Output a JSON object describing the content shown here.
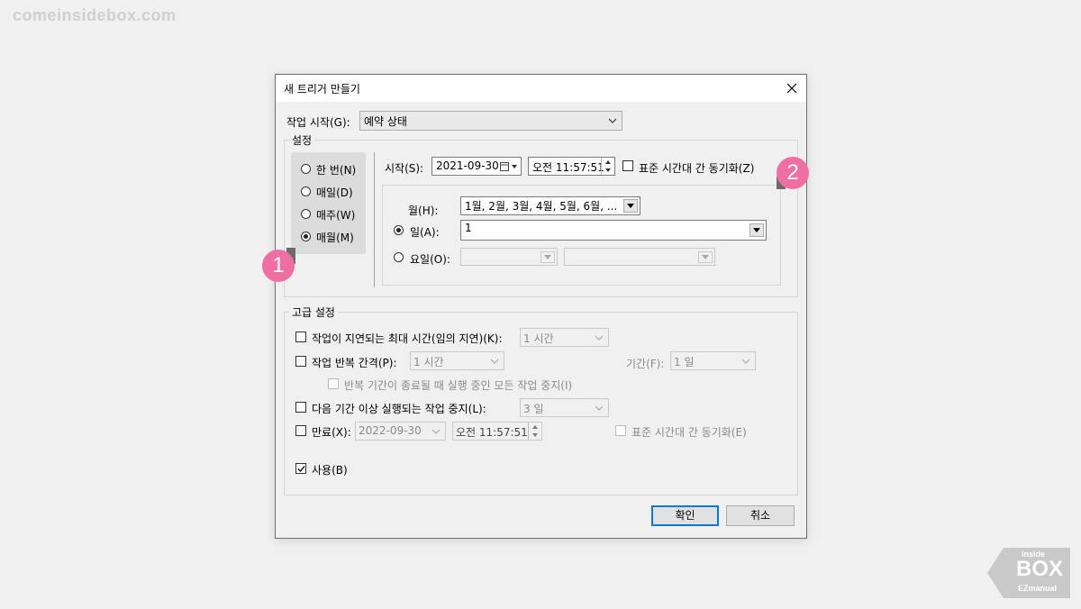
{
  "watermark": "comeinsidebox.com",
  "logo": {
    "text_top": "inside",
    "text_mid": "BOX",
    "text_bottom": "EZmanual"
  },
  "dialog": {
    "title": "새 트리거 만들기",
    "start_task_label": "작업 시작(G):",
    "start_task_value": "예약 상태",
    "settings_legend": "설정",
    "schedule_options": [
      {
        "label": "한 번(N)",
        "selected": false
      },
      {
        "label": "매일(D)",
        "selected": false
      },
      {
        "label": "매주(W)",
        "selected": false
      },
      {
        "label": "매월(M)",
        "selected": true
      }
    ],
    "start_label": "시작(S):",
    "start_date": "2021-09-30",
    "start_time": "오전 11:57:51",
    "sync_timezone_label": "표준 시간대 간 동기화(Z)",
    "month_label": "월(H):",
    "month_value": "1월, 2월, 3월, 4월, 5월, 6월, ...",
    "day_option_label": "일(A):",
    "day_value": "1",
    "weekday_option_label": "요일(O):",
    "advanced_legend": "고급 설정",
    "delay_label": "작업이 지연되는 최대 시간(임의 지연)(K):",
    "delay_value": "1 시간",
    "repeat_label": "작업 반복 간격(P):",
    "repeat_value": "1 시간",
    "duration_label": "기간(F):",
    "duration_value": "1 일",
    "stop_repeat_label": "반복 기간이 종료될 때 실행 중인 모든 작업 중지(I)",
    "stop_long_label": "다음 기간 이상 실행되는 작업 중지(L):",
    "stop_long_value": "3 일",
    "expire_label": "만료(X):",
    "expire_date": "2022-09-30",
    "expire_time": "오전 11:57:51",
    "expire_sync_label": "표준 시간대 간 동기화(E)",
    "enabled_label": "사용(B)",
    "ok_label": "확인",
    "cancel_label": "취소"
  },
  "annotations": {
    "badge1": "1",
    "badge2": "2",
    "color": "#ef6fa3"
  }
}
